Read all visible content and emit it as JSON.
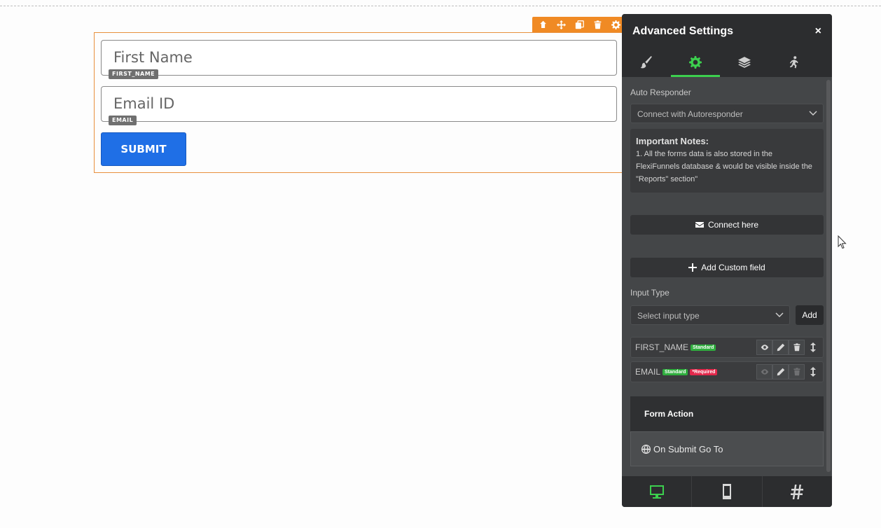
{
  "canvas": {
    "fields": [
      {
        "placeholder": "First Name",
        "tag": "FIRST_NAME"
      },
      {
        "placeholder": "Email ID",
        "tag": "EMAIL"
      }
    ],
    "submit_label": "SUBMIT",
    "toolbar_icons": [
      "arrow-up-icon",
      "move-icon",
      "duplicate-icon",
      "trash-icon",
      "gear-icon"
    ]
  },
  "panel": {
    "title": "Advanced Settings",
    "close": "×",
    "tabs": [
      {
        "icon": "brush-icon",
        "active": false
      },
      {
        "icon": "gear-icon",
        "active": true
      },
      {
        "icon": "layers-icon",
        "active": false
      },
      {
        "icon": "animation-icon",
        "active": false
      }
    ],
    "auto_responder": {
      "label": "Auto Responder",
      "select_value": "Connect with Autoresponder"
    },
    "notes": {
      "title": "Important Notes:",
      "text": "1. All the forms data is also stored in the FlexiFunnels database & would be visible inside the \"Reports\" section\""
    },
    "connect_button": "Connect here",
    "custom_field_button": "Add Custom field",
    "input_type": {
      "label": "Input Type",
      "select_value": "Select input type",
      "add_label": "Add"
    },
    "field_rows": [
      {
        "name": "FIRST_NAME",
        "badges": [
          "Standard"
        ]
      },
      {
        "name": "EMAIL",
        "badges": [
          "Standard",
          "*Required"
        ]
      }
    ],
    "form_action": {
      "title": "Form Action",
      "on_submit": "On Submit Go To"
    },
    "devices": [
      "desktop-icon",
      "mobile-icon",
      "hash-icon"
    ],
    "colors": {
      "accent": "#3ccf4e",
      "toolbar": "#f08a24",
      "button": "#1f6fe6"
    }
  }
}
